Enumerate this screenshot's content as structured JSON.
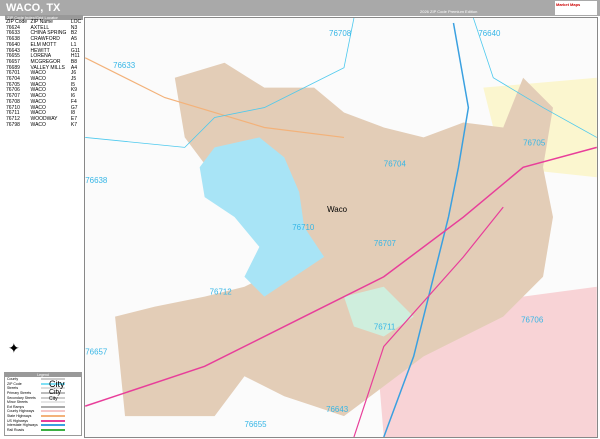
{
  "header": {
    "title": "WACO, TX",
    "edition": "2026 ZIP Code Premium Edition",
    "logo": "Market Maps"
  },
  "index": {
    "title": "ZIP Code Index/Grid Locator",
    "columns": [
      "ZIP Code",
      "ZIP Name",
      "LOC"
    ],
    "rows": [
      [
        "76624",
        "AXTELL",
        "N3"
      ],
      [
        "76633",
        "CHINA SPRING",
        "B2"
      ],
      [
        "76638",
        "CRAWFORD",
        "A5"
      ],
      [
        "76640",
        "ELM MOTT",
        "L1"
      ],
      [
        "76643",
        "HEWITT",
        "G11"
      ],
      [
        "76655",
        "LORENA",
        "H11"
      ],
      [
        "76657",
        "MCGREGOR",
        "B8"
      ],
      [
        "76689",
        "VALLEY MILLS",
        "A4"
      ],
      [
        "76701",
        "WACO",
        "J6"
      ],
      [
        "76704",
        "WACO",
        "J5"
      ],
      [
        "76705",
        "WACO",
        "I5"
      ],
      [
        "76706",
        "WACO",
        "K9"
      ],
      [
        "76707",
        "WACO",
        "I6"
      ],
      [
        "76708",
        "WACO",
        "F4"
      ],
      [
        "76710",
        "WACO",
        "G7"
      ],
      [
        "76711",
        "WACO",
        "I8"
      ],
      [
        "76712",
        "WOODWAY",
        "E7"
      ],
      [
        "76798",
        "WACO",
        "K7"
      ]
    ]
  },
  "map": {
    "city_label": "Waco",
    "zips": [
      {
        "z": "76708"
      },
      {
        "z": "76640"
      },
      {
        "z": "76633"
      },
      {
        "z": "76705"
      },
      {
        "z": "76638"
      },
      {
        "z": "76704"
      },
      {
        "z": "76710"
      },
      {
        "z": "76707"
      },
      {
        "z": "76712"
      },
      {
        "z": "76711"
      },
      {
        "z": "76706"
      },
      {
        "z": "76657"
      },
      {
        "z": "76643"
      },
      {
        "z": "76655"
      }
    ]
  },
  "legend": {
    "title": "Legend",
    "items": [
      {
        "label": "County",
        "color": "#cccccc"
      },
      {
        "label": "ZIP Code",
        "color": "#7fe0f5"
      },
      {
        "label": "Streets",
        "color": "#dddddd"
      },
      {
        "label": "Primary Streets",
        "color": "#bbbbbb"
      },
      {
        "label": "Secondary Streets",
        "color": "#cccccc"
      },
      {
        "label": "Minor Streets",
        "color": "#e5e5e5"
      },
      {
        "label": "Ext Ramps",
        "color": "#aaaaaa"
      },
      {
        "label": "County Highways",
        "color": "#f5c6c6"
      },
      {
        "label": "State Highways",
        "color": "#f3b27a"
      },
      {
        "label": "US Highways",
        "color": "#e83e9a"
      },
      {
        "label": "Interstate Highways",
        "color": "#3aa0e0"
      },
      {
        "label": "Rail Roads",
        "color": "#3cb043"
      }
    ],
    "cities": [
      "City",
      "City",
      "City"
    ]
  }
}
